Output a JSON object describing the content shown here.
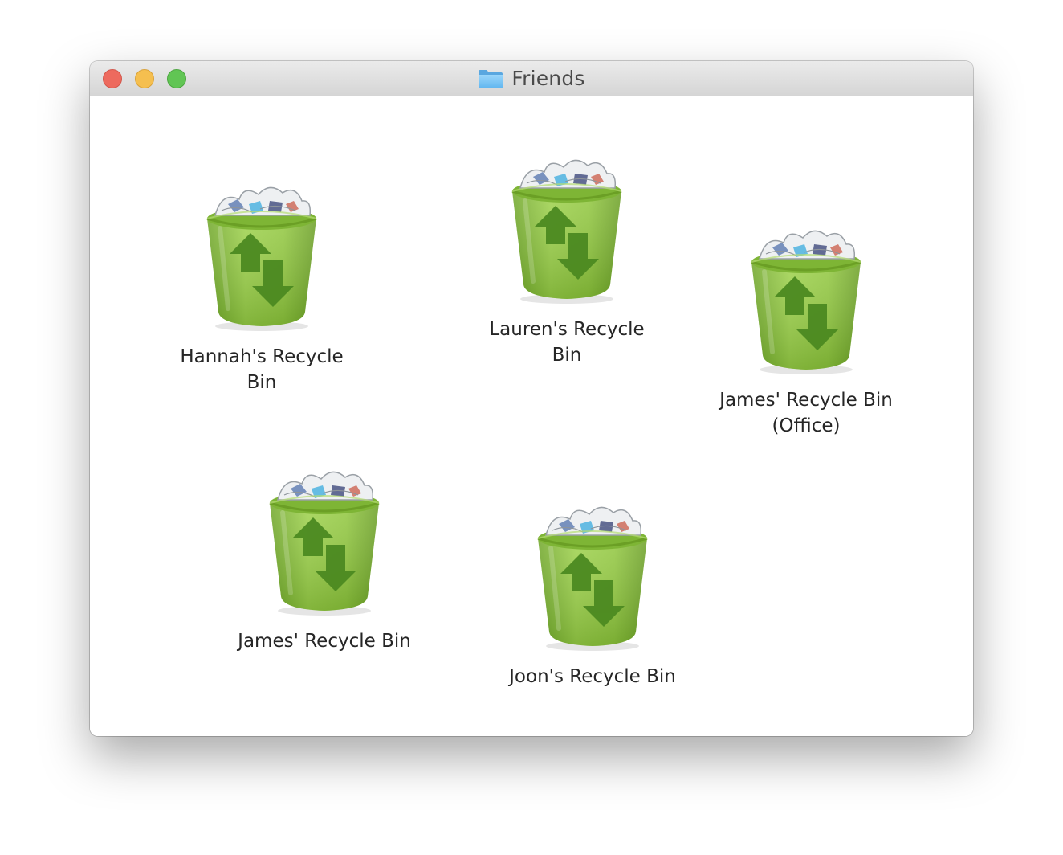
{
  "window": {
    "title": "Friends",
    "title_icon": "folder-icon",
    "controls": [
      "close",
      "minimize",
      "zoom"
    ]
  },
  "items": [
    {
      "label": "Hannah's Recycle\nBin",
      "icon": "recycle-bin-icon"
    },
    {
      "label": "Lauren's Recycle\nBin",
      "icon": "recycle-bin-icon"
    },
    {
      "label": "James' Recycle Bin\n(Office)",
      "icon": "recycle-bin-icon"
    },
    {
      "label": "James' Recycle Bin",
      "icon": "recycle-bin-icon"
    },
    {
      "label": "Joon's Recycle Bin",
      "icon": "recycle-bin-icon"
    }
  ],
  "colors": {
    "bin_green": "#8cc63f",
    "arrow_green": "#4c8a21",
    "folder_blue": "#7cc6f5"
  }
}
